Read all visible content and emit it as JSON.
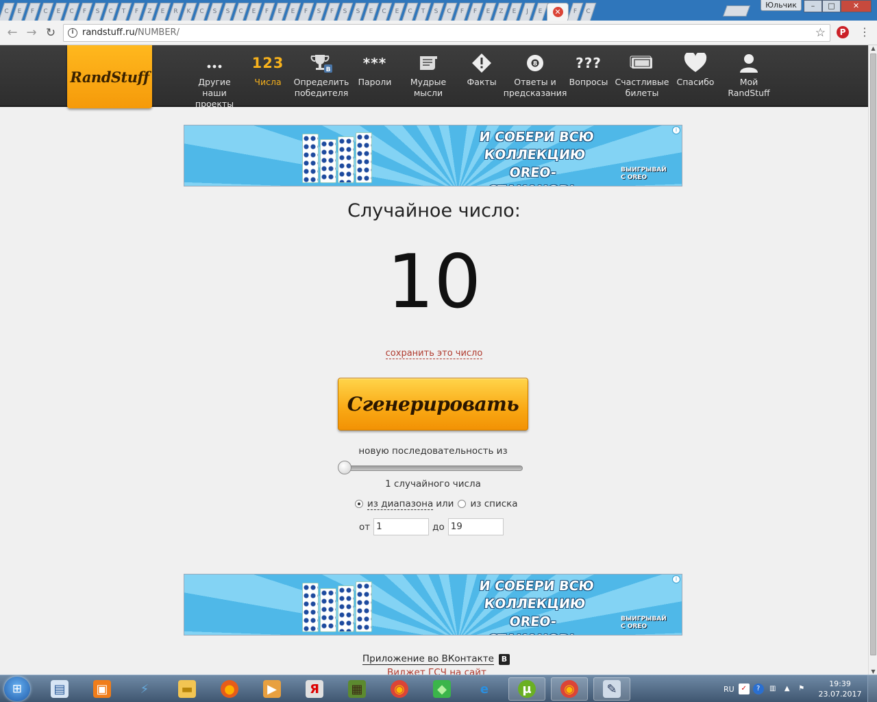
{
  "browser": {
    "tab_letters": [
      "C",
      "E",
      "F",
      "C",
      "E",
      "C",
      "F",
      "S",
      "C",
      "T",
      "F",
      "Z",
      "E",
      "R",
      "K",
      "C",
      "S",
      "S",
      "C",
      "E",
      "F",
      "E",
      "E",
      "F",
      "S",
      "F",
      "S",
      "S",
      "E",
      "C",
      "E",
      "C",
      "T",
      "S",
      "C",
      "F",
      "F",
      "E",
      "Z",
      "E",
      "J",
      "E"
    ],
    "tabs_after": [
      "F",
      "C"
    ],
    "user_name": "Юльчик",
    "url_host": "randstuff.ru/",
    "url_path": "NUMBER/"
  },
  "site": {
    "logo": "RandStuff",
    "nav": [
      {
        "label": "Другие наши проекты",
        "icon": "dots-icon",
        "active": false
      },
      {
        "label": "Числа",
        "icon": "numbers-icon",
        "glyph": "123",
        "active": true
      },
      {
        "label": "Определить победителя",
        "icon": "trophy-icon",
        "active": false
      },
      {
        "label": "Пароли",
        "icon": "password-icon",
        "glyph": "***",
        "active": false
      },
      {
        "label": "Мудрые мысли",
        "icon": "scroll-icon",
        "active": false
      },
      {
        "label": "Факты",
        "icon": "exclamation-icon",
        "active": false
      },
      {
        "label": "Ответы и предсказания",
        "icon": "magic-ball-icon",
        "active": false
      },
      {
        "label": "Вопросы",
        "icon": "questions-icon",
        "glyph": "???",
        "active": false
      },
      {
        "label": "Счастливые билеты",
        "icon": "ticket-icon",
        "active": false
      },
      {
        "label": "Спасибо",
        "icon": "heart-icon",
        "active": false
      },
      {
        "label": "Мой RandStuff",
        "icon": "user-icon",
        "active": false
      }
    ]
  },
  "ad": {
    "headline": [
      "И СОБЕРИ ВСЮ",
      "КОЛЛЕКЦИЮ",
      "OREO-СТАКАНОВ!"
    ],
    "brand": [
      "ВЫИГРЫВАЙ",
      "С OREO"
    ],
    "badge": "i"
  },
  "main": {
    "title": "Случайное число:",
    "number": "10",
    "save_link": "сохранить это число",
    "generate_button": "Сгенерировать",
    "sequence_text": "новую последовательность из",
    "count_text": "1 случайного числа",
    "mode_range": "из диапазона",
    "mode_or": "или",
    "mode_list": "из списка",
    "from_label": "от",
    "from_value": "1",
    "to_label": "до",
    "to_value": "19",
    "slider_fraction": 0.0
  },
  "footer": {
    "vk_app_link": "Приложение во ВКонтакте",
    "vk_badge": "B",
    "widget_link": "Виджет ГСЧ на сайт"
  },
  "taskbar": {
    "icons": [
      "display-settings-icon",
      "photo-icon",
      "network-icon",
      "folder-icon",
      "firefox-icon",
      "media-player-icon",
      "yandex-icon",
      "minecraft-icon",
      "chrome-icon",
      "sims-icon",
      "ie-icon",
      "utorrent-icon",
      "chrome-icon",
      "paint-icon"
    ],
    "lang": "RU",
    "time": "19:39",
    "date": "23.07.2017"
  },
  "colors": {
    "accent": "#f8b21c",
    "header_bg": "#333333",
    "link_red": "#b03a2e"
  }
}
